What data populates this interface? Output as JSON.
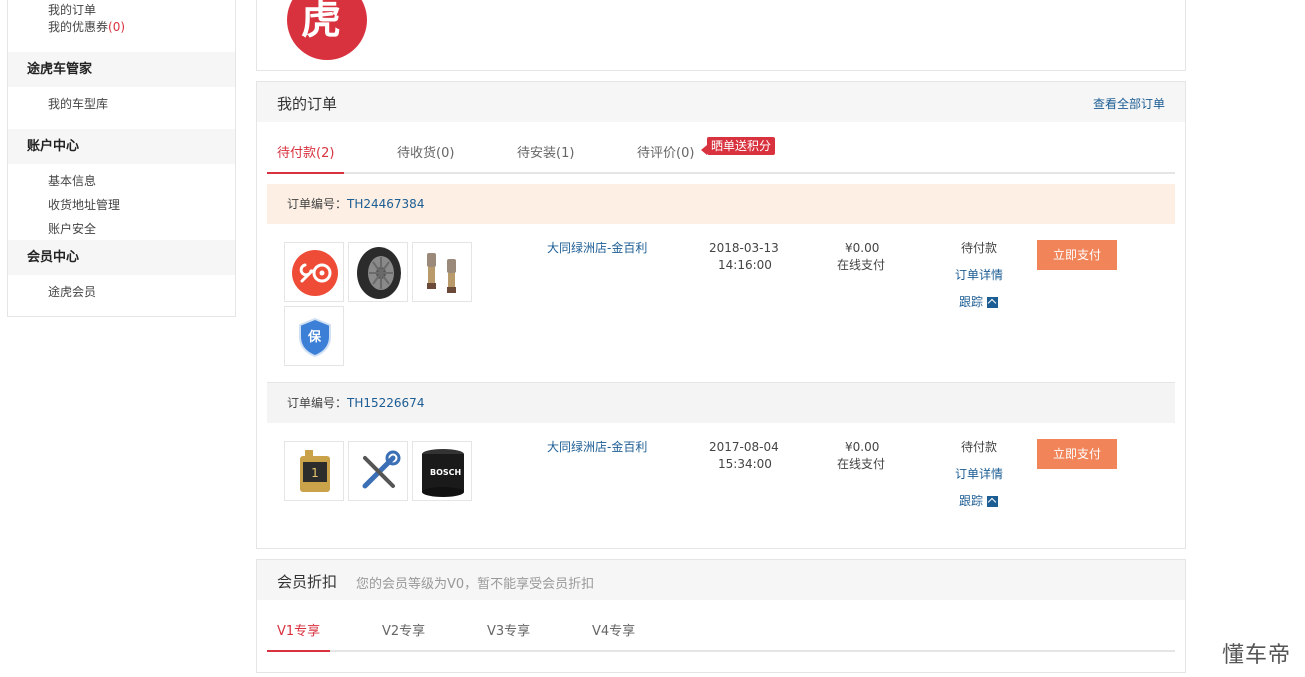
{
  "sidebar": {
    "my_orders": "我的订单",
    "my_coupons": "我的优惠券",
    "coupon_count": "(0)",
    "car_manager": "途虎车管家",
    "my_garage": "我的车型库",
    "account_center": "账户中心",
    "basic_info": "基本信息",
    "address_mgmt": "收货地址管理",
    "account_security": "账户安全",
    "member_center": "会员中心",
    "tuhu_member": "途虎会员"
  },
  "avatar": {
    "char": "虎",
    "color": "#d9323f"
  },
  "orders_panel": {
    "title": "我的订单",
    "view_all": "查看全部订单",
    "tabs": [
      "待付款(2)",
      "待收货(0)",
      "待安装(1)",
      "待评价(0)"
    ],
    "review_badge": "晒单送积分",
    "order_no_label": "订单编号：",
    "orders": [
      {
        "order_no": "TH24467384",
        "shop": "大同绿洲店-金百利",
        "date": "2018-03-13",
        "time": "14:16:00",
        "price": "¥0.00",
        "pay_method": "在线支付",
        "status": "待付款",
        "detail": "订单详情",
        "track": "跟踪",
        "pay_button": "立即支付",
        "items": [
          "service-icon",
          "tire-icon",
          "valve-icon",
          "insurance-icon"
        ],
        "insurance_label": "保"
      },
      {
        "order_no": "TH15226674",
        "shop": "大同绿洲店-金百利",
        "date": "2017-08-04",
        "time": "15:34:00",
        "price": "¥0.00",
        "pay_method": "在线支付",
        "status": "待付款",
        "detail": "订单详情",
        "track": "跟踪",
        "pay_button": "立即支付",
        "items": [
          "motor-oil-icon",
          "tools-icon",
          "oil-filter-icon"
        ],
        "filter_brand": "BOSCH"
      }
    ]
  },
  "member_panel": {
    "title": "会员折扣",
    "subtitle": "您的会员等级为V0，暂不能享受会员折扣",
    "tabs": [
      "V1专享",
      "V2专享",
      "V3专享",
      "V4专享"
    ]
  },
  "watermark": "懂车帝",
  "colors": {
    "accent": "#d9323f",
    "link": "#1c5d94",
    "button": "#f18459"
  }
}
